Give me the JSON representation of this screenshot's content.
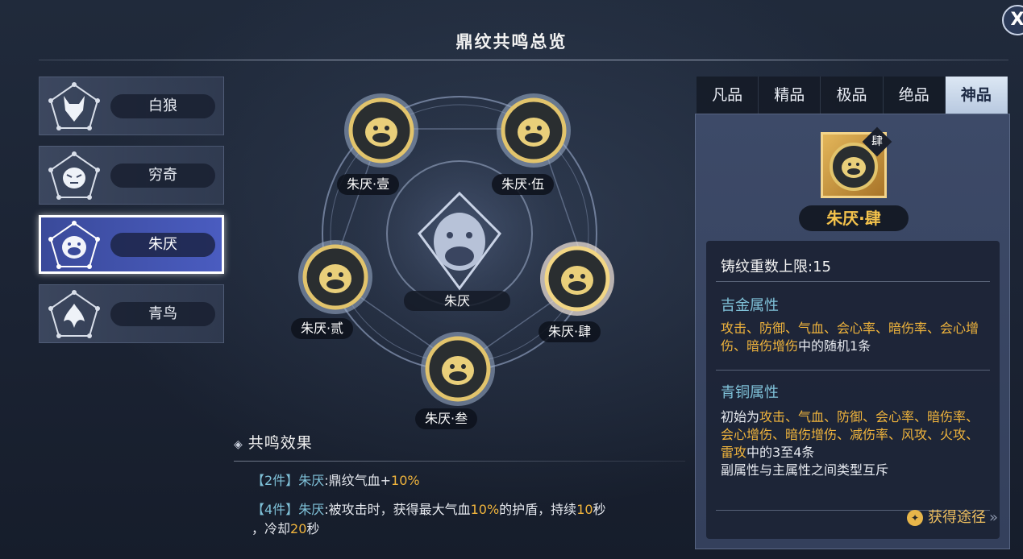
{
  "title": "鼎纹共鸣总览",
  "close_label": "X",
  "series": [
    {
      "name": "白狼",
      "icon": "wolf-icon",
      "active": false
    },
    {
      "name": "穷奇",
      "icon": "tiger-icon",
      "active": false
    },
    {
      "name": "朱厌",
      "icon": "ape-icon",
      "active": true
    },
    {
      "name": "青鸟",
      "icon": "bird-icon",
      "active": false
    }
  ],
  "wheel": {
    "center_label": "朱厌",
    "slots": [
      "朱厌·壹",
      "朱厌·伍",
      "朱厌·贰",
      "朱厌·肆",
      "朱厌·叁"
    ],
    "selected_slot": "朱厌·肆"
  },
  "effect": {
    "header": "共鸣效果",
    "row1": {
      "count": "【2件】",
      "set": "朱厌",
      "text1": ":鼎纹气血+",
      "value": "10%"
    },
    "row2": {
      "count": "【4件】",
      "set": "朱厌",
      "text1": ":被攻击时，获得最大气血",
      "v1": "10%",
      "text2": "的护盾，持续",
      "v2": "10",
      "text3": "秒",
      "text4": "，冷却",
      "v3": "20",
      "text5": "秒"
    }
  },
  "tabs": [
    "凡品",
    "精品",
    "极品",
    "绝品",
    "神品"
  ],
  "active_tab": "神品",
  "detail": {
    "item_tag": "肆",
    "item_name": "朱厌·肆",
    "cap": "铸纹重数上限:15",
    "gold_title": "吉金属性",
    "gold_attrs": "攻击、防御、气血、会心率、暗伤率、会心增伤、暗伤增伤",
    "gold_suffix": "中的随机1条",
    "bronze_title": "青铜属性",
    "bronze_prefix": "初始为",
    "bronze_attrs": "攻击、气血、防御、会心率、暗伤率、会心增伤、暗伤增伤、减伤率、风攻、火攻、雷攻",
    "bronze_suffix": "中的3至4条",
    "bronze_note": "副属性与主属性之间类型互斥",
    "obtain_label": "获得途径"
  },
  "colors": {
    "accent_gold": "#f0b43c",
    "accent_blue": "#7fc1d8",
    "active_tab": "#c6d6ea",
    "active_series": "#4a5cc0"
  }
}
